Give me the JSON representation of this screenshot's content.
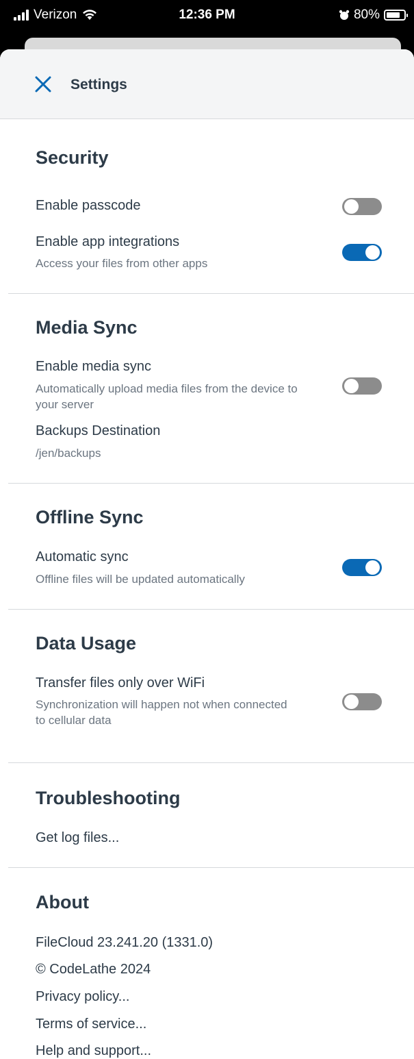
{
  "status_bar": {
    "carrier": "Verizon",
    "time": "12:36 PM",
    "battery": "80%",
    "battery_level": 0.8
  },
  "header": {
    "title": "Settings",
    "close_icon": "close-icon"
  },
  "colors": {
    "accent": "#0a69b5",
    "toggle_off": "#8c8c8c",
    "text": "#2d3b48",
    "subtext": "#6b7580"
  },
  "security": {
    "title": "Security",
    "passcode": {
      "label": "Enable passcode",
      "enabled": false
    },
    "integrations": {
      "label": "Enable app integrations",
      "sub": "Access your files from other apps",
      "enabled": true
    }
  },
  "media_sync": {
    "title": "Media Sync",
    "enable": {
      "label": "Enable media sync",
      "sub": "Automatically upload media files from the device to your server",
      "enabled": false
    },
    "backups": {
      "label": "Backups Destination",
      "value": "/jen/backups"
    }
  },
  "offline_sync": {
    "title": "Offline Sync",
    "automatic": {
      "label": "Automatic sync",
      "sub": "Offline files will be updated automatically",
      "enabled": true
    }
  },
  "data_usage": {
    "title": "Data Usage",
    "wifi_only": {
      "label": "Transfer files only over WiFi",
      "sub": "Synchronization will happen not when connected to cellular data",
      "enabled": false
    }
  },
  "troubleshooting": {
    "title": "Troubleshooting",
    "logs": "Get log files..."
  },
  "about": {
    "title": "About",
    "version": "FileCloud 23.241.20 (1331.0)",
    "copyright": "© CodeLathe 2024",
    "privacy": "Privacy policy...",
    "terms": "Terms of service...",
    "help": "Help and support..."
  }
}
